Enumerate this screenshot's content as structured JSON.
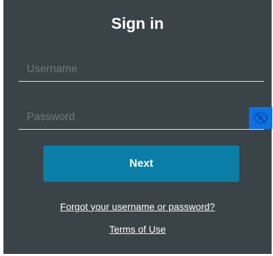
{
  "title": "Sign in",
  "username": {
    "placeholder": "Username",
    "value": ""
  },
  "password": {
    "placeholder": "Password",
    "value": ""
  },
  "password_toggle_icon": "eye-slash-icon",
  "next_label": "Next",
  "forgot_link": "Forgot your username or password?",
  "terms_link": "Terms of Use",
  "colors": {
    "panel": "#3a4348",
    "next_button": "#0a7ea7",
    "toggle_button": "#0b72e6",
    "text": "#ffffff",
    "placeholder": "#6e787e"
  }
}
